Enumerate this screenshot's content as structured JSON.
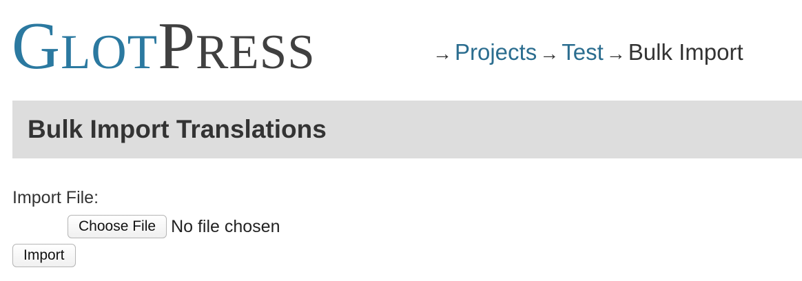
{
  "header": {
    "logo_text": "GlotPress",
    "logo_parts": {
      "g": "G",
      "lot": "LOT",
      "p": "P",
      "ress": "RESS"
    },
    "breadcrumb": {
      "separator": "→",
      "items": [
        "Projects",
        "Test"
      ],
      "current": "Bulk Import"
    }
  },
  "page": {
    "title": "Bulk Import Translations"
  },
  "form": {
    "import_file_label": "Import File:",
    "choose_file_label": "Choose File",
    "no_file_text": "No file chosen",
    "import_button_label": "Import"
  },
  "colors": {
    "logo_blue": "#2b79a0",
    "logo_gray": "#404040",
    "link": "#2b6d8f",
    "title_bar_bg": "#dddddd"
  }
}
